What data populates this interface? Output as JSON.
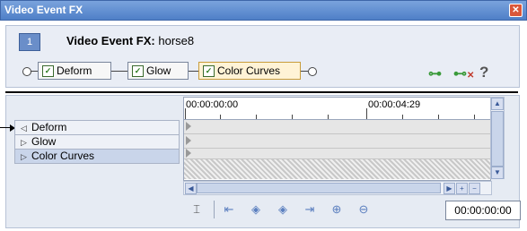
{
  "window": {
    "title": "Video Event FX",
    "close_icon": "close-icon"
  },
  "header": {
    "event_number": "1",
    "event_label": "Video Event FX:",
    "event_name": "horse8"
  },
  "fx_chain": [
    {
      "label": "Deform",
      "checked": true,
      "active": false
    },
    {
      "label": "Glow",
      "checked": true,
      "active": false
    },
    {
      "label": "Color Curves",
      "checked": true,
      "active": true
    }
  ],
  "toolbar_icons": [
    "plugin-chain-icon",
    "remove-plugin-icon",
    "help-icon"
  ],
  "help_glyph": "?",
  "tracks": [
    {
      "label": "Deform",
      "expanded": true,
      "selected": false
    },
    {
      "label": "Glow",
      "expanded": false,
      "selected": false
    },
    {
      "label": "Color Curves",
      "expanded": false,
      "selected": true
    }
  ],
  "timeline": {
    "start_timecode": "00:00:00:00",
    "mid_timecode": "00:00:04:29"
  },
  "transport": {
    "current_timecode": "00:00:00:00",
    "icons": [
      "sync-cursor-icon",
      "first-keyframe-icon",
      "prev-keyframe-icon",
      "next-keyframe-icon",
      "last-keyframe-icon",
      "add-keyframe-icon",
      "delete-keyframe-icon"
    ]
  },
  "colors": {
    "titlebar": "#5b87cf",
    "panel": "#e9edf5",
    "active_fx_border": "#c89c3a",
    "check_green": "#2b7a1e"
  }
}
